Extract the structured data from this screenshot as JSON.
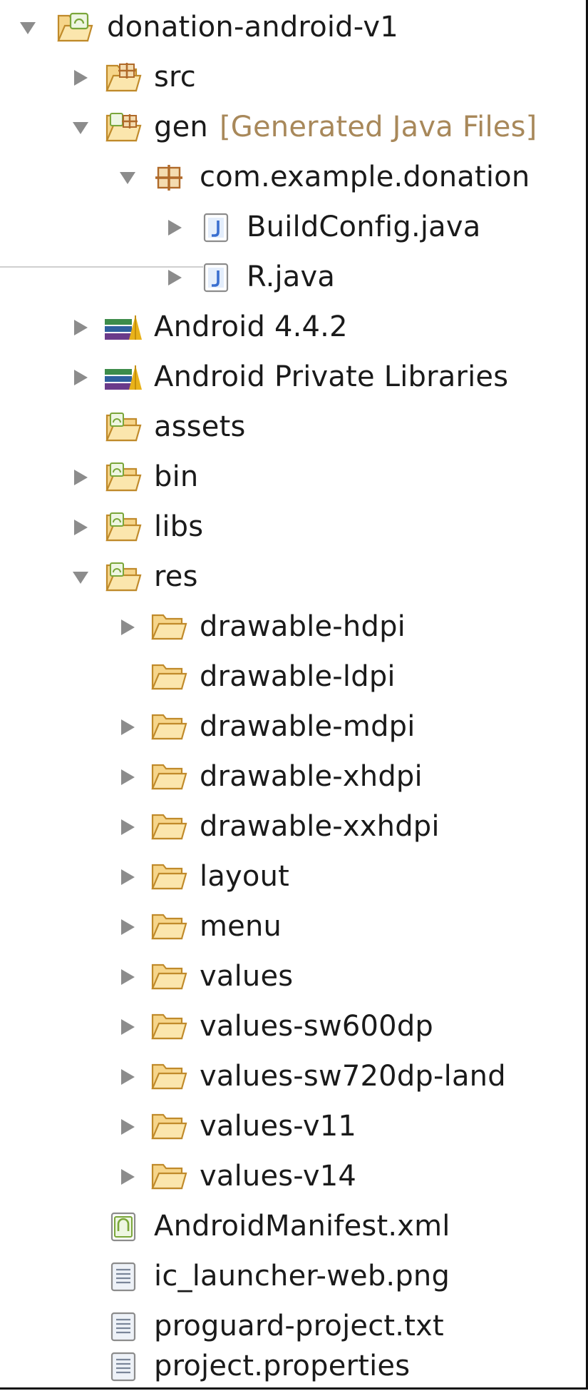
{
  "project_tree": {
    "root": {
      "label": "donation-android-v1",
      "expanded": true
    },
    "items": [
      {
        "id": "src",
        "label": "src",
        "icon": "source-folder-icon",
        "expanded": false
      },
      {
        "id": "gen",
        "label": "gen",
        "decoration": "[Generated Java Files]",
        "icon": "android-source-folder-icon",
        "expanded": true
      },
      {
        "id": "pkg",
        "label": "com.example.donation",
        "icon": "package-icon",
        "expanded": true
      },
      {
        "id": "buildconfig",
        "label": "BuildConfig.java",
        "icon": "java-file-icon",
        "expanded": false
      },
      {
        "id": "rjava",
        "label": "R.java",
        "icon": "java-file-icon",
        "expanded": false
      },
      {
        "id": "android442",
        "label": "Android 4.4.2",
        "icon": "library-icon",
        "expanded": false
      },
      {
        "id": "privlibs",
        "label": "Android Private Libraries",
        "icon": "library-icon",
        "expanded": false
      },
      {
        "id": "assets",
        "label": "assets",
        "icon": "android-folder-icon"
      },
      {
        "id": "bin",
        "label": "bin",
        "icon": "android-folder-icon",
        "expanded": false
      },
      {
        "id": "libs",
        "label": "libs",
        "icon": "android-folder-icon",
        "expanded": false
      },
      {
        "id": "res",
        "label": "res",
        "icon": "android-folder-icon",
        "expanded": true
      },
      {
        "id": "dhdpi",
        "label": "drawable-hdpi",
        "icon": "folder-icon",
        "expanded": false
      },
      {
        "id": "dldpi",
        "label": "drawable-ldpi",
        "icon": "folder-icon"
      },
      {
        "id": "dmdpi",
        "label": "drawable-mdpi",
        "icon": "folder-icon",
        "expanded": false
      },
      {
        "id": "dxhdpi",
        "label": "drawable-xhdpi",
        "icon": "folder-icon",
        "expanded": false
      },
      {
        "id": "dxxhdpi",
        "label": "drawable-xxhdpi",
        "icon": "folder-icon",
        "expanded": false
      },
      {
        "id": "layout",
        "label": "layout",
        "icon": "folder-icon",
        "expanded": false
      },
      {
        "id": "menu",
        "label": "menu",
        "icon": "folder-icon",
        "expanded": false
      },
      {
        "id": "values",
        "label": "values",
        "icon": "folder-icon",
        "expanded": false
      },
      {
        "id": "v600",
        "label": "values-sw600dp",
        "icon": "folder-icon",
        "expanded": false
      },
      {
        "id": "v720",
        "label": "values-sw720dp-land",
        "icon": "folder-icon",
        "expanded": false
      },
      {
        "id": "v11",
        "label": "values-v11",
        "icon": "folder-icon",
        "expanded": false
      },
      {
        "id": "v14",
        "label": "values-v14",
        "icon": "folder-icon",
        "expanded": false
      },
      {
        "id": "manifest",
        "label": "AndroidManifest.xml",
        "icon": "android-manifest-icon"
      },
      {
        "id": "icweb",
        "label": "ic_launcher-web.png",
        "icon": "text-file-icon"
      },
      {
        "id": "proguard",
        "label": "proguard-project.txt",
        "icon": "text-file-icon"
      },
      {
        "id": "props",
        "label": "project.properties",
        "icon": "text-file-icon"
      }
    ]
  },
  "colors": {
    "arrow": "#8c8c8c",
    "text": "#1a1a1a",
    "decoration": "#a8885a",
    "folder_fill": "#f6d58a",
    "folder_stroke": "#c08a2a",
    "package": "#b06a2a",
    "java_blue": "#3a6fd0",
    "android_green": "#7aa63a"
  }
}
